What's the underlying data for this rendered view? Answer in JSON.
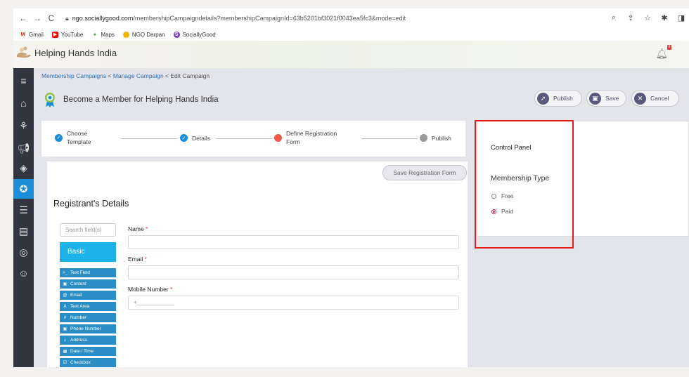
{
  "browser": {
    "url_host": "ngo.sociallygood.com",
    "url_path": "/membershipCampaigndetails?membershipCampaignId=63b5201bf3021f0043ea5fc3&mode=edit",
    "bookmarks": [
      {
        "label": "Gmail",
        "icon": "gmail-icon",
        "color": "#d93025",
        "glyph": "M"
      },
      {
        "label": "YouTube",
        "icon": "youtube-icon",
        "color": "#ff0000",
        "glyph": "▶"
      },
      {
        "label": "Maps",
        "icon": "maps-icon",
        "color": "#34a853",
        "glyph": "●"
      },
      {
        "label": "NGO Darpan",
        "icon": "ngo-darpan-icon",
        "color": "#f2b600",
        "glyph": "●"
      },
      {
        "label": "SociallyGood",
        "icon": "sociallygood-icon",
        "color": "#7b3fc4",
        "glyph": "S"
      }
    ]
  },
  "header": {
    "app_title": "Helping Hands India",
    "notification_count": "8"
  },
  "breadcrumb": {
    "item1": "Membership Campaigns",
    "item2": "Manage Campaign",
    "item3": "Edit Campaign",
    "separator": "<"
  },
  "page": {
    "title": "Become a Member for Helping Hands India"
  },
  "actions": {
    "publish": "Publish",
    "save": "Save",
    "cancel": "Cancel"
  },
  "stepper": {
    "steps": [
      {
        "line1": "Choose",
        "line2": "Template",
        "state": "done"
      },
      {
        "line1": "Details",
        "line2": "",
        "state": "done"
      },
      {
        "line1": "Define Registration",
        "line2": "Form",
        "state": "current"
      },
      {
        "line1": "Publish",
        "line2": "",
        "state": "todo"
      }
    ]
  },
  "form": {
    "save_registration_label": "Save Registration Form",
    "section_title": "Registrant's Details",
    "search_placeholder": "Search field(s)",
    "basic_tab": "Basic",
    "field_types": [
      {
        "label": "Text Field",
        "glyph": ">_"
      },
      {
        "label": "Content",
        "glyph": "▣"
      },
      {
        "label": "Email",
        "glyph": "@"
      },
      {
        "label": "Text Area",
        "glyph": "A"
      },
      {
        "label": "Number",
        "glyph": "#"
      },
      {
        "label": "Phone Number",
        "glyph": "▣"
      },
      {
        "label": "Address",
        "glyph": "⌂"
      },
      {
        "label": "Date / Time",
        "glyph": "▦"
      },
      {
        "label": "Checkbox",
        "glyph": "☑"
      }
    ],
    "fields": [
      {
        "label": "Name",
        "value": ""
      },
      {
        "label": "Email",
        "value": ""
      },
      {
        "label": "Mobile Number",
        "value": "+____________"
      }
    ]
  },
  "control_panel": {
    "title": "Control Panel",
    "membership_type_label": "Membership Type",
    "options": [
      {
        "label": "Free",
        "selected": false
      },
      {
        "label": "Paid",
        "selected": true
      }
    ]
  }
}
